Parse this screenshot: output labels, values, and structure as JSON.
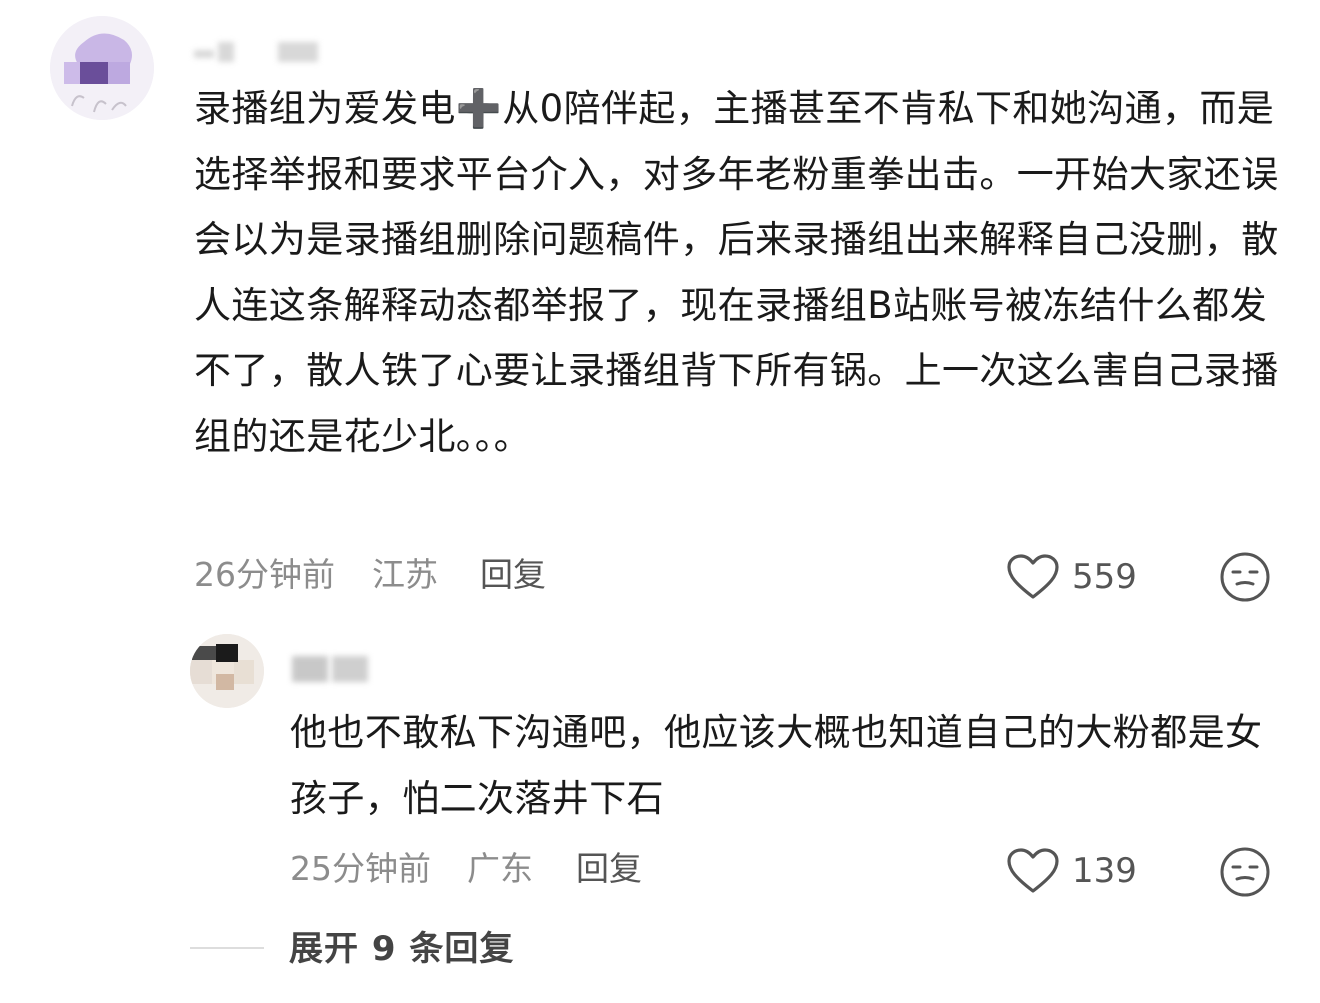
{
  "comment": {
    "text": "录播组为爱发电➕从0陪伴起，主播甚至不肯私下和她沟通，而是选择举报和要求平台介入，对多年老粉重拳出击。一开始大家还误会以为是录播组删除问题稿件，后来录播组出来解释自己没删，散人连这条解释动态都举报了，现在录播组B站账号被冻结什么都发不了，散人铁了心要让录播组背下所有锅。上一次这么害自己录播组的还是花少北。。。",
    "time": "26分钟前",
    "location": "江苏",
    "reply_label": "回复",
    "likes": "559",
    "like_icon": "heart-outline-icon",
    "dislike_icon": "meh-face-icon"
  },
  "reply": {
    "text": "他也不敢私下沟通吧，他应该大概也知道自己的大粉都是女孩子，怕二次落井下石",
    "time": "25分钟前",
    "location": "广东",
    "reply_label": "回复",
    "likes": "139",
    "like_icon": "heart-outline-icon",
    "dislike_icon": "meh-face-icon"
  },
  "expand": {
    "label": "展开 9 条回复"
  },
  "colors": {
    "text": "#1a1a1a",
    "meta": "#8c8c8c",
    "icon": "#555555"
  }
}
